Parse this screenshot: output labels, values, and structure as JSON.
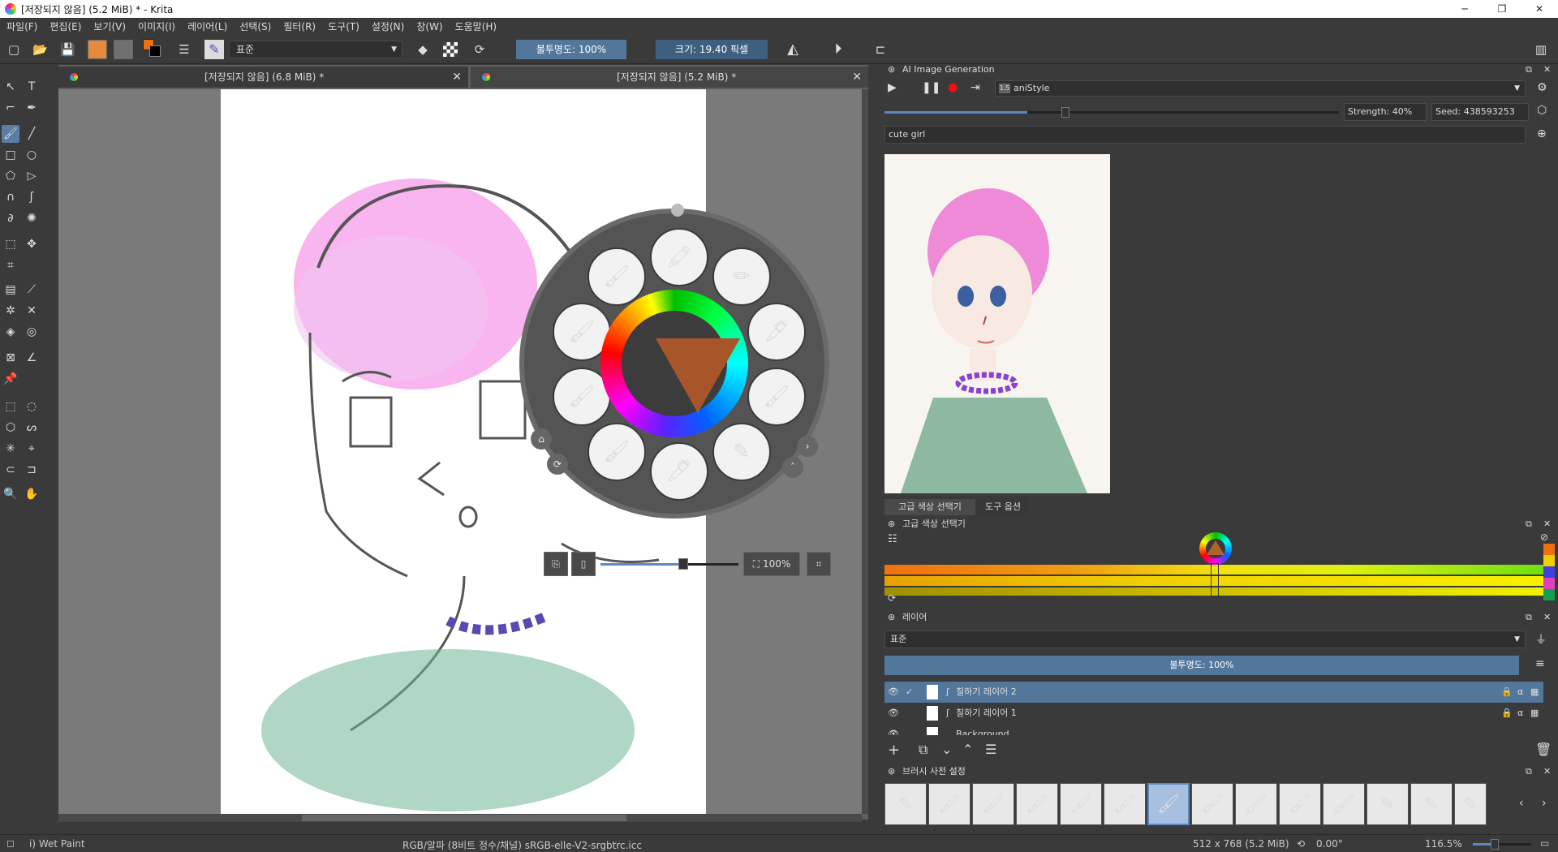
{
  "window": {
    "title": "[저장되지 않음]  (5.2 MiB) * - Krita",
    "minimize": "─",
    "maximize": "❐",
    "close": "✕"
  },
  "menu": [
    "파일(F)",
    "편집(E)",
    "보기(V)",
    "이미지(I)",
    "레이어(L)",
    "선택(S)",
    "필터(R)",
    "도구(T)",
    "설정(N)",
    "창(W)",
    "도움말(H)"
  ],
  "toolbar": {
    "blend_mode": "표준",
    "opacity_label": "불투명도: 100%",
    "size_label": "크기: 19.40 픽셀"
  },
  "documents": [
    {
      "title": "[저장되지 않음]  (6.8 MiB) *"
    },
    {
      "title": "[저장되지 않음]  (5.2 MiB) *"
    }
  ],
  "popup_palette": {
    "zoom_label": "100%"
  },
  "ai_panel": {
    "title": "AI Image Generation",
    "style": "aniStyle",
    "strength": "Strength: 40%",
    "seed": "Seed: 438593253",
    "prompt": "cute girl"
  },
  "tabs": {
    "color_selector": "고급 색상 선택기",
    "tool_options": "도구 옵션"
  },
  "color_panel": {
    "title": "고급 색상 선택기"
  },
  "layers_panel": {
    "title": "레이어",
    "blend_mode": "표준",
    "opacity": "불투명도: 100%",
    "layers": [
      {
        "name": "칠하기 레이어 2",
        "selected": true
      },
      {
        "name": "칠하기 레이어 1",
        "selected": false
      },
      {
        "name": "Background",
        "selected": false
      }
    ]
  },
  "brush_presets": {
    "title": "브러시 사전 설정"
  },
  "statusbar": {
    "brush": "i) Wet Paint",
    "color_model": "RGB/알파 (8비트 정수/채널)  sRGB-elle-V2-srgbtrc.icc",
    "image_size": "512 x 768 (5.2 MiB)",
    "rotation": "0.00°",
    "zoom": "116.5%"
  },
  "colors": {
    "accent": "#53769b",
    "foreground": "#f07010",
    "background_color": "#000000"
  }
}
